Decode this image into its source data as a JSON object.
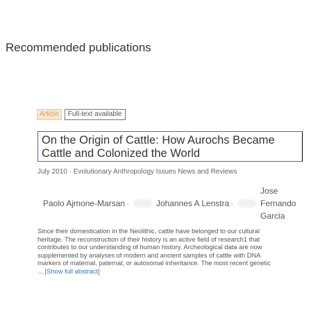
{
  "section": {
    "title": "Recommended publications"
  },
  "publication": {
    "type_badge": "Article",
    "fulltext_badge": "Full-text available",
    "title": "On the Origin of Cattle: How Aurochs Became Cattle and Colonized the World",
    "meta": "July 2010 · Evolutionary Anthropology Issues News and Reviews",
    "authors": [
      "Paolo Ajmone-Marsan",
      "Johannes A Lenstra",
      "Jose Fernando Garcia"
    ],
    "author_separator": "·",
    "abstract": "Since their domestication in the Neolithic, cattle have belonged to our cultural heritage. The reconstruction of their history is an active field of research1 that contributes to our understanding of human history. Archeological data are now supplemented by analyses of modern and ancient samples of cattle with DNA markers of maternal, paternal, or autosomal inheritance. The most recent genetic ...",
    "show_full_label": "[Show full abstract]"
  }
}
